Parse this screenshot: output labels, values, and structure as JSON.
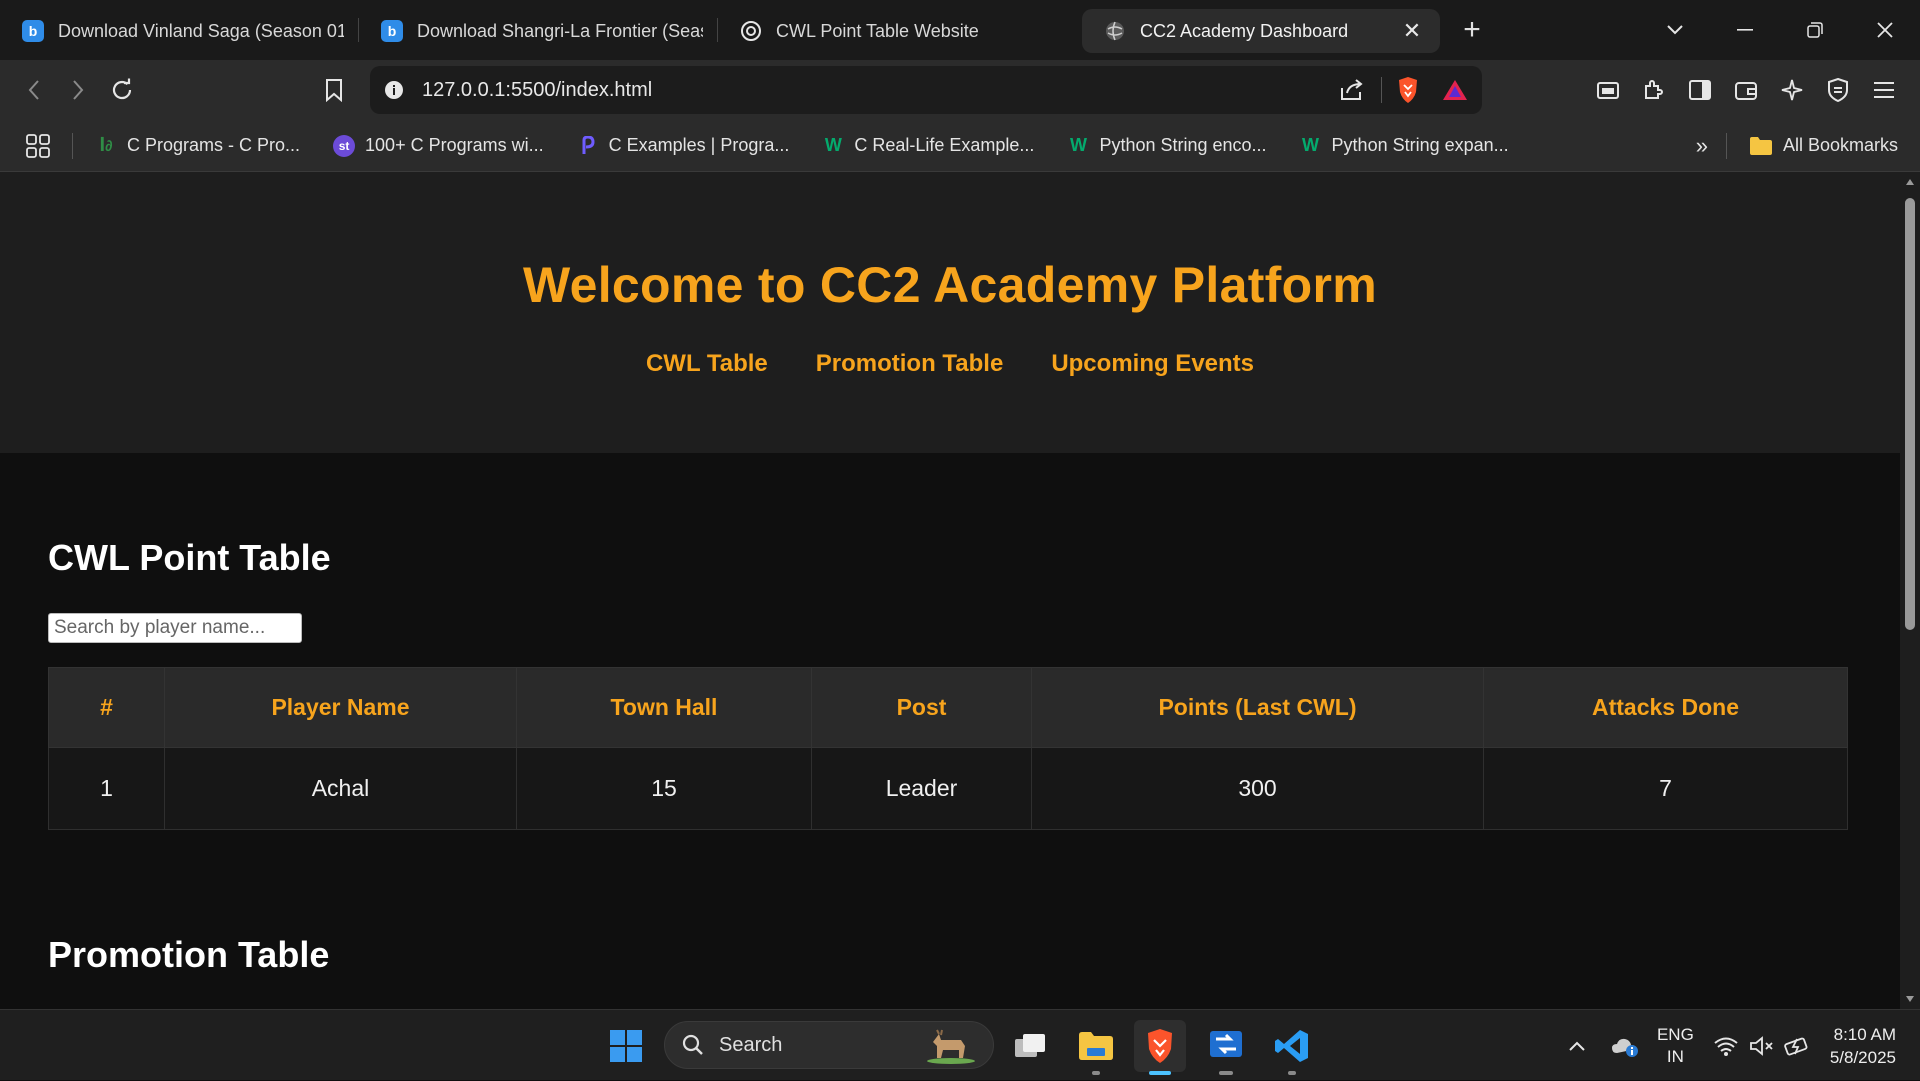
{
  "browser": {
    "tabs": [
      {
        "title": "Download Vinland Saga (Season 01",
        "icon": "bing-icon"
      },
      {
        "title": "Download Shangri-La Frontier (Seas",
        "icon": "bing-icon"
      },
      {
        "title": "CWL Point Table Website",
        "icon": "globe-icon"
      },
      {
        "title": "CC2 Academy Dashboard",
        "icon": "globe-icon",
        "active": true
      }
    ],
    "new_tab": "+",
    "url": "127.0.0.1:5500/index.html",
    "bookmarks": [
      {
        "label": "C Programs - C Pro...",
        "icon": "gfg-icon"
      },
      {
        "label": "100+ C Programs wi...",
        "icon": "st-icon"
      },
      {
        "label": "C Examples | Progra...",
        "icon": "programiz-icon"
      },
      {
        "label": "C Real-Life Example...",
        "icon": "w3schools-icon"
      },
      {
        "label": "Python String enco...",
        "icon": "w3schools-icon"
      },
      {
        "label": "Python String expan...",
        "icon": "w3schools-icon"
      }
    ],
    "bookmarks_overflow": "»",
    "all_bookmarks": "All Bookmarks"
  },
  "site": {
    "title": "Welcome to CC2 Academy Platform",
    "nav": [
      "CWL Table",
      "Promotion Table",
      "Upcoming Events"
    ],
    "cwl": {
      "heading": "CWL Point Table",
      "search_placeholder": "Search by player name...",
      "columns": [
        "#",
        "Player Name",
        "Town Hall",
        "Post",
        "Points (Last CWL)",
        "Attacks Done"
      ],
      "rows": [
        [
          "1",
          "Achal",
          "15",
          "Leader",
          "300",
          "7"
        ]
      ]
    },
    "promotion": {
      "heading": "Promotion Table"
    },
    "accent_color": "#f7a41d"
  },
  "taskbar": {
    "search_label": "Search",
    "lang_line1": "ENG",
    "lang_line2": "IN",
    "time": "8:10 AM",
    "date": "5/8/2025"
  }
}
